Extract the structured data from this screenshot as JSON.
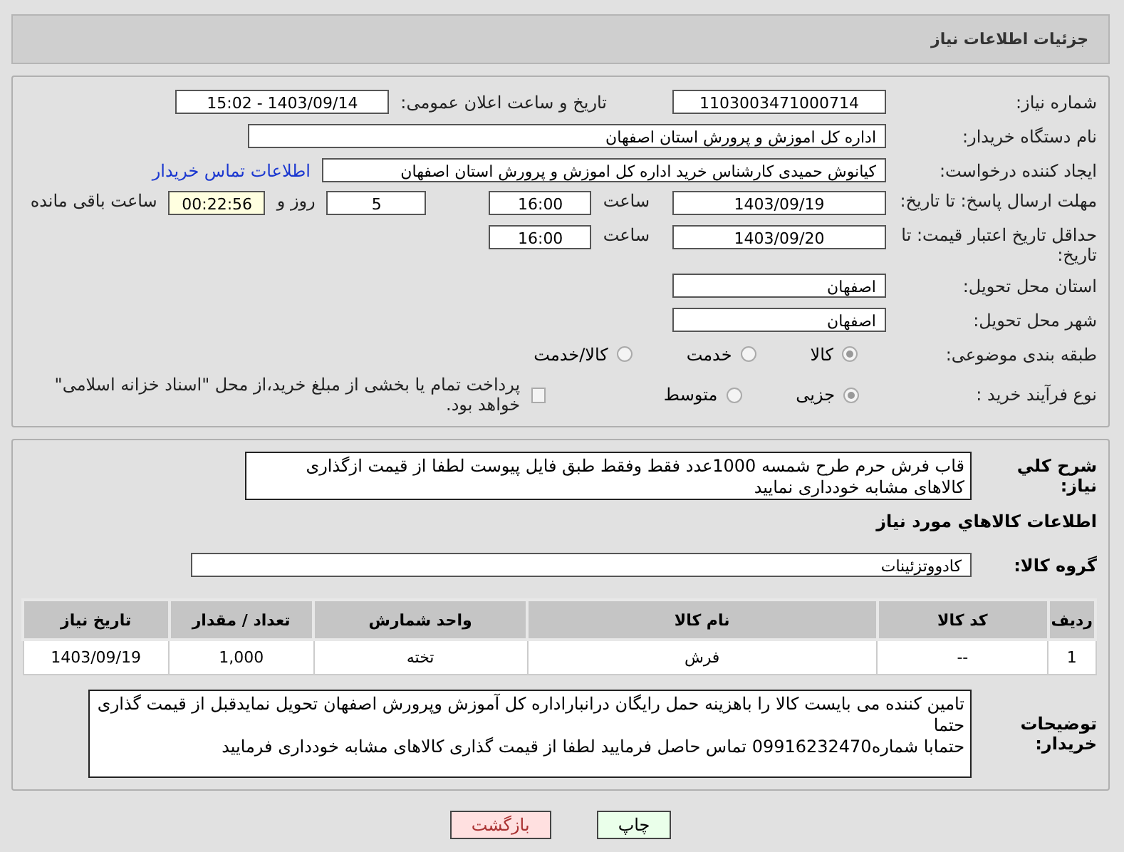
{
  "header": {
    "title": "جزئیات اطلاعات نیاز"
  },
  "need_number": {
    "label": "شماره نیاز:",
    "value": "1103003471000714"
  },
  "announce": {
    "label": "تاریخ و ساعت اعلان عمومی:",
    "value": "1403/09/14 - 15:02"
  },
  "buyer_org": {
    "label": "نام دستگاه خریدار:",
    "value": "اداره کل اموزش و پرورش استان اصفهان"
  },
  "requester": {
    "label": "ایجاد کننده درخواست:",
    "value": "کیانوش حمیدی کارشناس خرید اداره کل اموزش و پرورش استان اصفهان",
    "link": "اطلاعات تماس خریدار"
  },
  "deadline": {
    "label": "مهلت ارسال پاسخ: تا تاریخ:",
    "date": "1403/09/19",
    "time_label": "ساعت",
    "time": "16:00",
    "days": "5",
    "days_label": "روز و",
    "remaining": "00:22:56",
    "remaining_label": "ساعت باقی مانده"
  },
  "price_validity": {
    "label": "حداقل تاریخ اعتبار قیمت: تا تاریخ:",
    "date": "1403/09/20",
    "time_label": "ساعت",
    "time": "16:00"
  },
  "province": {
    "label": "استان محل تحویل:",
    "value": "اصفهان"
  },
  "city": {
    "label": "شهر محل تحویل:",
    "value": "اصفهان"
  },
  "category": {
    "label": "طبقه بندی موضوعی:",
    "options": [
      {
        "label": "کالا",
        "selected": true
      },
      {
        "label": "خدمت",
        "selected": false
      },
      {
        "label": "کالا/خدمت",
        "selected": false
      }
    ]
  },
  "process": {
    "label": "نوع فرآیند خرید :",
    "options": [
      {
        "label": "جزیی",
        "selected": true
      },
      {
        "label": "متوسط",
        "selected": false
      }
    ],
    "treasury": {
      "label": "پرداخت تمام یا بخشی از مبلغ خرید،از محل \"اسناد خزانه اسلامی\" خواهد بود.",
      "checked": false
    }
  },
  "description": {
    "label": "شرح کلي نياز:",
    "value": "قاب فرش حرم طرح شمسه 1000عدد فقط وفقط طبق فایل پیوست لطفا از قیمت ازگذاری کالاهای مشابه خودداری نمایید"
  },
  "goods_heading": "اطلاعات کالاهاي مورد نياز",
  "goods_group": {
    "label": "گروه کالا:",
    "value": "کادووتزئینات"
  },
  "table": {
    "columns": [
      "ردیف",
      "کد کالا",
      "نام کالا",
      "واحد شمارش",
      "تعداد / مقدار",
      "تاریخ نیاز"
    ],
    "rows": [
      [
        "1",
        "--",
        "فرش",
        "تخته",
        "1,000",
        "1403/09/19"
      ]
    ]
  },
  "buyer_notes": {
    "label": "توضیحات خریدار:",
    "lines": [
      "تامین کننده می بایست کالا را باهزینه حمل رایگان درانباراداره کل آموزش وپرورش  اصفهان تحویل نمایدقبل از قیمت گذاری حتما",
      "حتمابا شماره09916232470 تماس حاصل فرمایید  لطفا از قیمت گذاری کالاهای مشابه خودداری فرمایید"
    ]
  },
  "buttons": [
    {
      "kind": "print",
      "label": "چاپ"
    },
    {
      "kind": "back",
      "label": "بازگشت"
    }
  ]
}
